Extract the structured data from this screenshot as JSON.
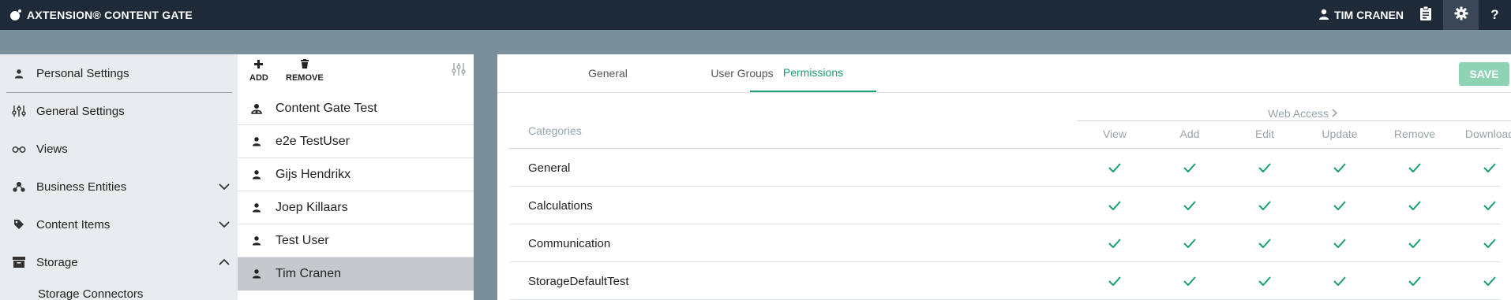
{
  "header": {
    "app_title": "AXTENSION® CONTENT GATE",
    "user_name": "TIM CRANEN",
    "help_label": "?"
  },
  "sidebar": {
    "items": [
      {
        "label": "Personal Settings",
        "icon": "person-icon"
      },
      {
        "label": "General Settings",
        "icon": "sliders-icon"
      },
      {
        "label": "Views",
        "icon": "glasses-icon"
      },
      {
        "label": "Business Entities",
        "icon": "network-icon",
        "expandable": true,
        "expanded": false
      },
      {
        "label": "Content Items",
        "icon": "tag-icon",
        "expandable": true,
        "expanded": false
      },
      {
        "label": "Storage",
        "icon": "archive-icon",
        "expandable": true,
        "expanded": true
      }
    ],
    "sub_item": "Storage Connectors"
  },
  "users_panel": {
    "add_label": "ADD",
    "remove_label": "REMOVE",
    "users": [
      {
        "name": "Content Gate Test",
        "icon": "user-group-icon",
        "selected": false
      },
      {
        "name": "e2e TestUser",
        "icon": "person-icon",
        "selected": false
      },
      {
        "name": "Gijs Hendrikx",
        "icon": "person-icon",
        "selected": false
      },
      {
        "name": "Joep Killaars",
        "icon": "person-icon",
        "selected": false
      },
      {
        "name": "Test User",
        "icon": "person-icon",
        "selected": false
      },
      {
        "name": "Tim Cranen",
        "icon": "person-icon",
        "selected": true
      }
    ]
  },
  "main": {
    "tabs": [
      {
        "label": "General",
        "active": false
      },
      {
        "label": "User Groups",
        "active": false
      },
      {
        "label": "Permissions",
        "active": true
      }
    ],
    "save_label": "SAVE",
    "permissions": {
      "categories_header": "Categories",
      "group_header": "Web Access",
      "columns": [
        "View",
        "Add",
        "Edit",
        "Update",
        "Remove",
        "Download"
      ],
      "rows": [
        {
          "category": "General",
          "checks": [
            true,
            true,
            true,
            true,
            true,
            true
          ]
        },
        {
          "category": "Calculations",
          "checks": [
            true,
            true,
            true,
            true,
            true,
            true
          ]
        },
        {
          "category": "Communication",
          "checks": [
            true,
            true,
            true,
            true,
            true,
            true
          ]
        },
        {
          "category": "StorageDefaultTest",
          "checks": [
            true,
            true,
            true,
            true,
            true,
            true
          ]
        }
      ]
    }
  },
  "colors": {
    "topbar": "#1e2a38",
    "accent": "#16a06c",
    "save_button": "#8fd3b4",
    "background": "#7b8f9b"
  }
}
